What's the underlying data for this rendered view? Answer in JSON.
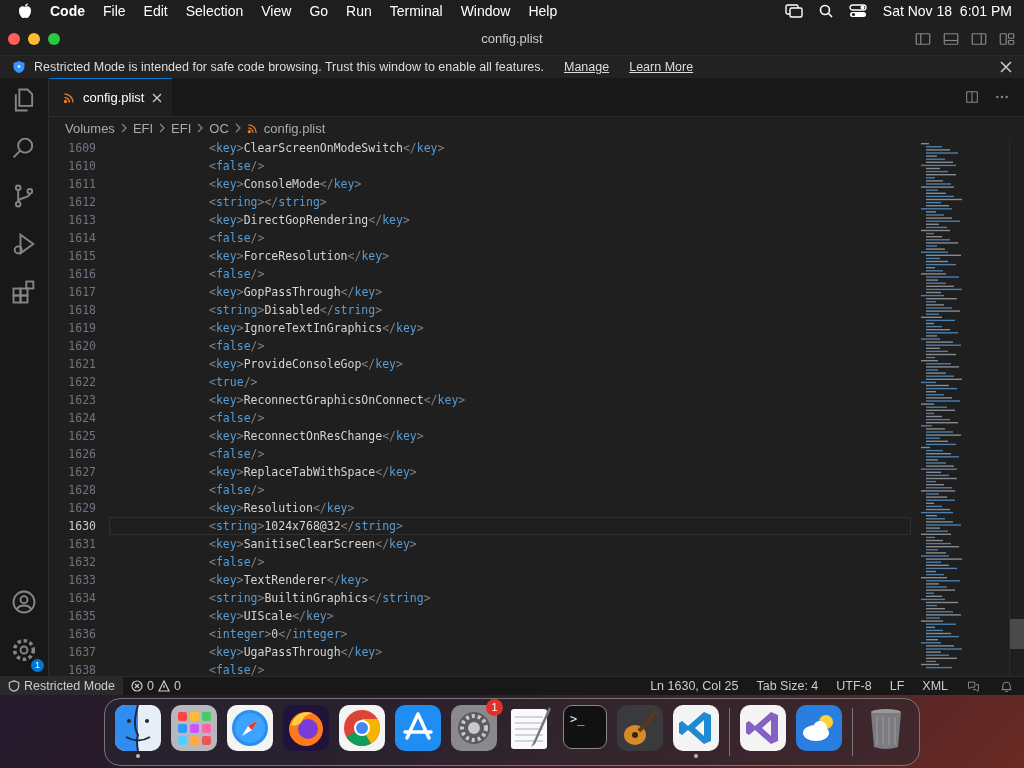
{
  "menu_bar": {
    "app": "Code",
    "menus": [
      "File",
      "Edit",
      "Selection",
      "View",
      "Go",
      "Run",
      "Terminal",
      "Window",
      "Help"
    ],
    "clock": "Sat Nov 18  6:01 PM"
  },
  "window": {
    "title": "config.plist"
  },
  "banner": {
    "message": "Restricted Mode is intended for safe code browsing. Trust this window to enable all features.",
    "links": [
      "Manage",
      "Learn More"
    ]
  },
  "activity_bar": {
    "settings_badge": "1"
  },
  "tabs": [
    {
      "label": "config.plist",
      "selected": true
    }
  ],
  "breadcrumbs": [
    "Volumes",
    "EFI",
    "EFI",
    "OC",
    "config.plist"
  ],
  "editor": {
    "lines": [
      {
        "number": "1609",
        "text": "<key>ClearScreenOnModeSwitch</key>",
        "current": false
      },
      {
        "number": "1610",
        "text": "<false/>",
        "current": false
      },
      {
        "number": "1611",
        "text": "<key>ConsoleMode</key>",
        "current": false
      },
      {
        "number": "1612",
        "text": "<string></string>",
        "current": false
      },
      {
        "number": "1613",
        "text": "<key>DirectGopRendering</key>",
        "current": false
      },
      {
        "number": "1614",
        "text": "<false/>",
        "current": false
      },
      {
        "number": "1615",
        "text": "<key>ForceResolution</key>",
        "current": false
      },
      {
        "number": "1616",
        "text": "<false/>",
        "current": false
      },
      {
        "number": "1617",
        "text": "<key>GopPassThrough</key>",
        "current": false
      },
      {
        "number": "1618",
        "text": "<string>Disabled</string>",
        "current": false
      },
      {
        "number": "1619",
        "text": "<key>IgnoreTextInGraphics</key>",
        "current": false
      },
      {
        "number": "1620",
        "text": "<false/>",
        "current": false
      },
      {
        "number": "1621",
        "text": "<key>ProvideConsoleGop</key>",
        "current": false
      },
      {
        "number": "1622",
        "text": "<true/>",
        "current": false
      },
      {
        "number": "1623",
        "text": "<key>ReconnectGraphicsOnConnect</key>",
        "current": false
      },
      {
        "number": "1624",
        "text": "<false/>",
        "current": false
      },
      {
        "number": "1625",
        "text": "<key>ReconnectOnResChange</key>",
        "current": false
      },
      {
        "number": "1626",
        "text": "<false/>",
        "current": false
      },
      {
        "number": "1627",
        "text": "<key>ReplaceTabWithSpace</key>",
        "current": false
      },
      {
        "number": "1628",
        "text": "<false/>",
        "current": false
      },
      {
        "number": "1629",
        "text": "<key>Resolution</key>",
        "current": false
      },
      {
        "number": "1630",
        "text": "<string>1024x768@32</string>",
        "current": true
      },
      {
        "number": "1631",
        "text": "<key>SanitiseClearScreen</key>",
        "current": false
      },
      {
        "number": "1632",
        "text": "<false/>",
        "current": false
      },
      {
        "number": "1633",
        "text": "<key>TextRenderer</key>",
        "current": false
      },
      {
        "number": "1634",
        "text": "<string>BuiltinGraphics</string>",
        "current": false
      },
      {
        "number": "1635",
        "text": "<key>UIScale</key>",
        "current": false
      },
      {
        "number": "1636",
        "text": "<integer>0</integer>",
        "current": false
      },
      {
        "number": "1637",
        "text": "<key>UgaPassThrough</key>",
        "current": false
      },
      {
        "number": "1638",
        "text": "<false/>",
        "current": false
      }
    ]
  },
  "status_bar": {
    "mode": "Restricted Mode",
    "errors": "0",
    "warnings": "0",
    "items": [
      "Ln 1630, Col 25",
      "Tab Size: 4",
      "UTF-8",
      "LF",
      "XML"
    ]
  },
  "dock": {
    "apps": [
      {
        "kind": "finder",
        "running": true
      },
      {
        "kind": "launchpad",
        "running": false
      },
      {
        "kind": "safari",
        "running": false
      },
      {
        "kind": "firefox",
        "running": false
      },
      {
        "kind": "chrome",
        "running": false
      },
      {
        "kind": "appstore",
        "running": false
      },
      {
        "kind": "settings",
        "running": false,
        "badge": "1"
      },
      {
        "kind": "textedit",
        "running": false
      },
      {
        "kind": "terminal",
        "running": false,
        "label": ">_"
      },
      {
        "kind": "guitar",
        "running": false
      },
      {
        "kind": "vscode",
        "running": true
      },
      {
        "kind": "divider"
      },
      {
        "kind": "vs",
        "running": false
      },
      {
        "kind": "weather",
        "running": false
      },
      {
        "kind": "divider"
      },
      {
        "kind": "trash",
        "running": false
      }
    ]
  }
}
